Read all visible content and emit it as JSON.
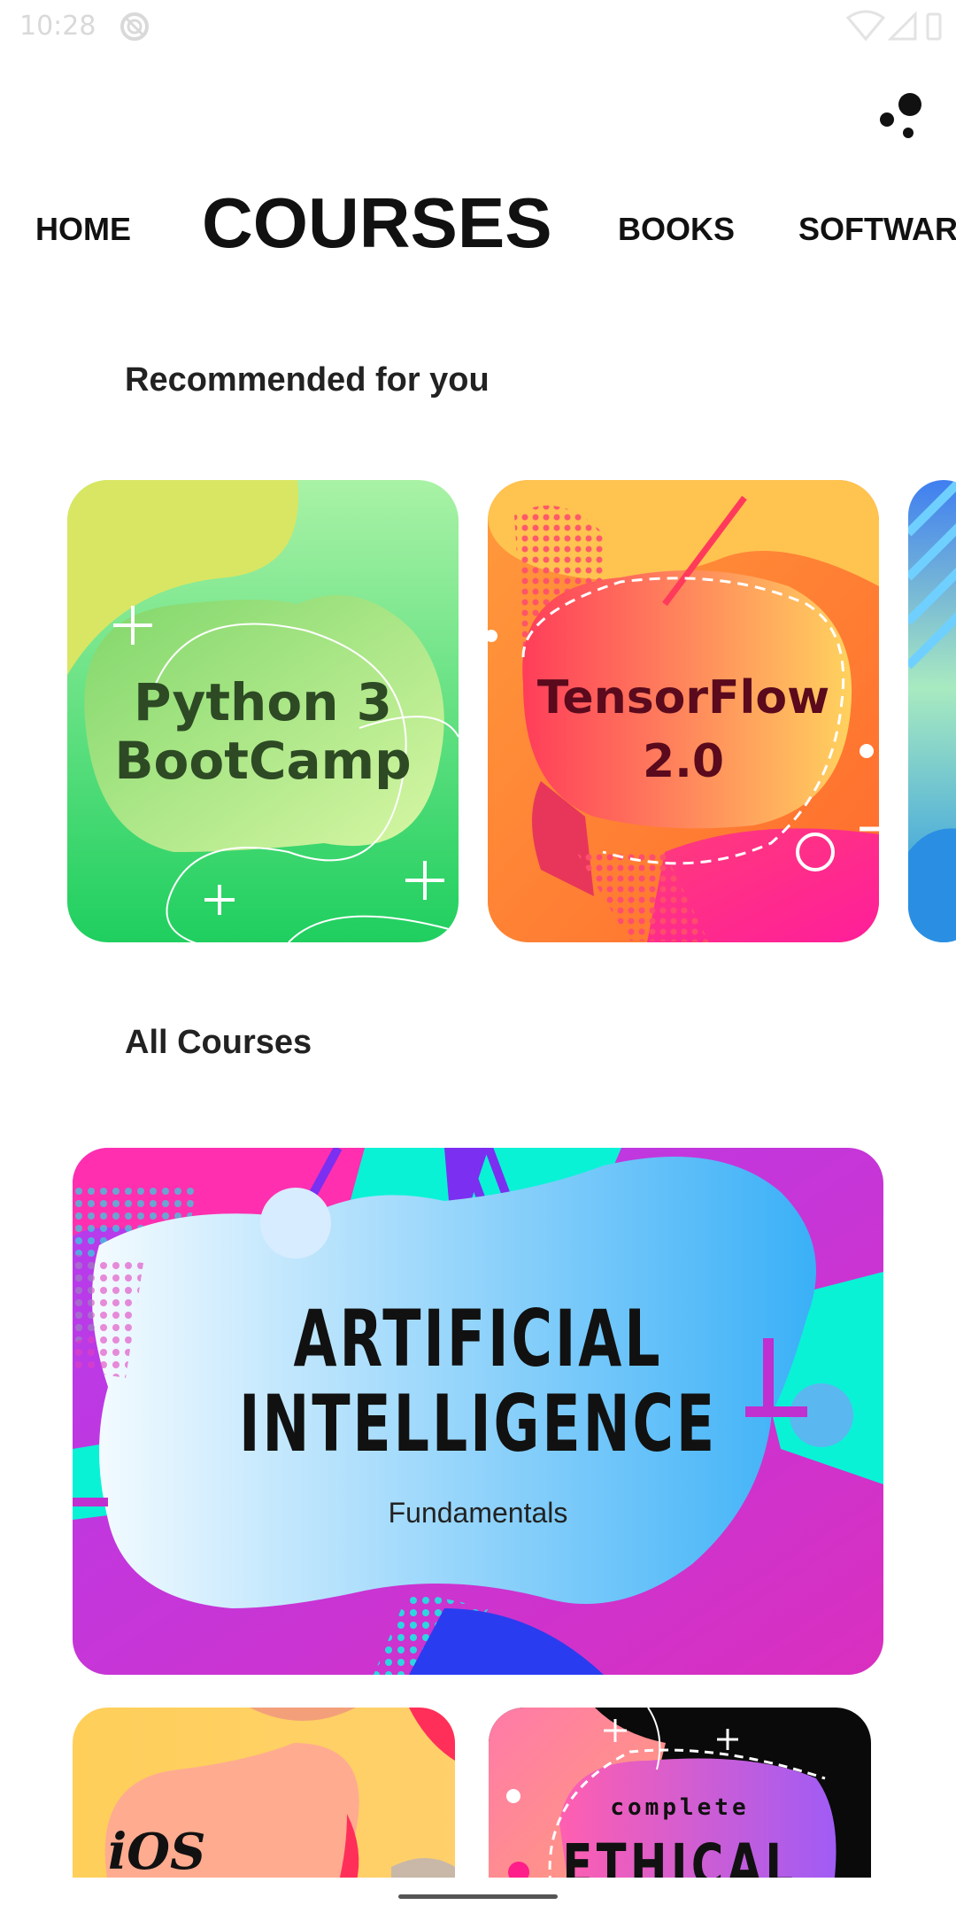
{
  "status_bar": {
    "time": "10:28"
  },
  "tabs": [
    {
      "label": "HOME"
    },
    {
      "label": "COURSES"
    },
    {
      "label": "BOOKS"
    },
    {
      "label": "SOFTWARE"
    }
  ],
  "sections": {
    "recommended": "Recommended for you",
    "all_courses": "All Courses"
  },
  "recommended": [
    {
      "line1": "Python 3",
      "line2": "BootCamp"
    },
    {
      "line1": "TensorFlow",
      "line2": "2.0"
    }
  ],
  "all_courses": {
    "featured": {
      "line1": "ARTIFICIAL",
      "line2": "INTELLIGENCE",
      "subtitle": "Fundamentals"
    },
    "ios": {
      "label": "iOS"
    },
    "ethical": {
      "subtitle": "complete",
      "title": "ETHICAL"
    }
  }
}
